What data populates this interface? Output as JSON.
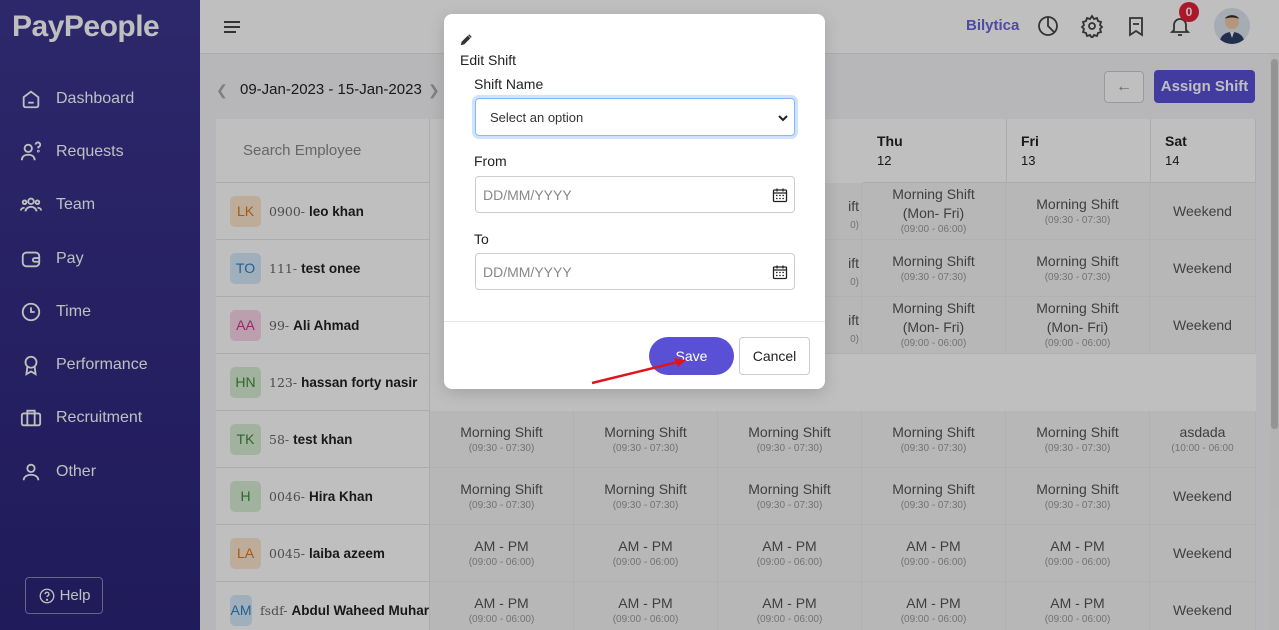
{
  "app": {
    "logo": "PayPeople",
    "brand": "Bilytica",
    "notifications": "0"
  },
  "sidebar": {
    "items": [
      {
        "label": "Dashboard",
        "icon": "home-icon"
      },
      {
        "label": "Requests",
        "icon": "user-question-icon"
      },
      {
        "label": "Team",
        "icon": "team-icon"
      },
      {
        "label": "Pay",
        "icon": "wallet-icon"
      },
      {
        "label": "Time",
        "icon": "clock-icon"
      },
      {
        "label": "Performance",
        "icon": "award-icon"
      },
      {
        "label": "Recruitment",
        "icon": "briefcase-icon"
      },
      {
        "label": "Other",
        "icon": "person-icon"
      }
    ],
    "help": "Help"
  },
  "toolbar": {
    "date_range": "09-Jan-2023 - 15-Jan-2023",
    "assign_label": "Assign Shift"
  },
  "grid": {
    "search_placeholder": "Search Employee",
    "days": [
      {
        "name": "Thu",
        "num": "12"
      },
      {
        "name": "Fri",
        "num": "13"
      },
      {
        "name": "Sat",
        "num": "14"
      }
    ],
    "employees": [
      {
        "initials": "LK",
        "code": "0900-",
        "name": "leo khan",
        "color": "#fde6cc",
        "fg": "#d97a1e"
      },
      {
        "initials": "TO",
        "code": "111-",
        "name": "test onee",
        "color": "#d5ebfb",
        "fg": "#2f7fc1"
      },
      {
        "initials": "AA",
        "code": "99-",
        "name": "Ali Ahmad",
        "color": "#fbd5ea",
        "fg": "#c7388a"
      },
      {
        "initials": "HN",
        "code": "123-",
        "name": "hassan forty nasir",
        "color": "#d7efd3",
        "fg": "#3c8a37"
      },
      {
        "initials": "TK",
        "code": "58-",
        "name": "test khan",
        "color": "#d7efd3",
        "fg": "#3c8a37"
      },
      {
        "initials": "H",
        "code": "0046-",
        "name": "Hira Khan",
        "color": "#d7efd3",
        "fg": "#3c8a37"
      },
      {
        "initials": "LA",
        "code": "0045-",
        "name": "laiba azeem",
        "color": "#fde6cc",
        "fg": "#d97a1e"
      },
      {
        "initials": "AM",
        "code": "fsdf-",
        "name": "Abdul Waheed Muhar",
        "color": "#d5ebfb",
        "fg": "#2f7fc1"
      }
    ],
    "rows": [
      [
        {
          "n": "",
          "t": "",
          "partial": "ift",
          "pt": "0)"
        },
        {
          "n": "Morning Shift\n(Mon- Fri)",
          "t": "(09:00 - 06:00)"
        },
        {
          "n": "Morning Shift",
          "t": "(09:30 - 07:30)"
        },
        {
          "n": "Weekend",
          "t": ""
        }
      ],
      [
        {
          "n": "",
          "t": "",
          "partial": "ift",
          "pt": "0)"
        },
        {
          "n": "Morning Shift",
          "t": "(09:30 - 07:30)"
        },
        {
          "n": "Morning Shift",
          "t": "(09:30 - 07:30)"
        },
        {
          "n": "Weekend",
          "t": ""
        }
      ],
      [
        {
          "n": "",
          "t": "",
          "partial": "ift",
          "pt": "0)"
        },
        {
          "n": "Morning Shift\n(Mon- Fri)",
          "t": "(09:00 - 06:00)"
        },
        {
          "n": "Morning Shift\n(Mon- Fri)",
          "t": "(09:00 - 06:00)"
        },
        {
          "n": "Weekend",
          "t": ""
        }
      ]
    ],
    "full_rows": [
      [
        {
          "n": "Morning Shift",
          "t": "(09:30 - 07:30)"
        },
        {
          "n": "Morning Shift",
          "t": "(09:30 - 07:30)"
        },
        {
          "n": "Morning Shift",
          "t": "(09:30 - 07:30)"
        },
        {
          "n": "Morning Shift",
          "t": "(09:30 - 07:30)"
        },
        {
          "n": "Morning Shift",
          "t": "(09:30 - 07:30)"
        },
        {
          "n": "asdada",
          "t": "(10:00 - 06:00"
        }
      ],
      [
        {
          "n": "Morning Shift",
          "t": "(09:30 - 07:30)"
        },
        {
          "n": "Morning Shift",
          "t": "(09:30 - 07:30)"
        },
        {
          "n": "Morning Shift",
          "t": "(09:30 - 07:30)"
        },
        {
          "n": "Morning Shift",
          "t": "(09:30 - 07:30)"
        },
        {
          "n": "Morning Shift",
          "t": "(09:30 - 07:30)"
        },
        {
          "n": "Weekend",
          "t": ""
        }
      ],
      [
        {
          "n": "AM - PM",
          "t": "(09:00 - 06:00)"
        },
        {
          "n": "AM - PM",
          "t": "(09:00 - 06:00)"
        },
        {
          "n": "AM - PM",
          "t": "(09:00 - 06:00)"
        },
        {
          "n": "AM - PM",
          "t": "(09:00 - 06:00)"
        },
        {
          "n": "AM - PM",
          "t": "(09:00 - 06:00)"
        },
        {
          "n": "Weekend",
          "t": ""
        }
      ],
      [
        {
          "n": "AM - PM",
          "t": "(09:00 - 06:00)"
        },
        {
          "n": "AM - PM",
          "t": "(09:00 - 06:00)"
        },
        {
          "n": "AM - PM",
          "t": "(09:00 - 06:00)"
        },
        {
          "n": "AM - PM",
          "t": "(09:00 - 06:00)"
        },
        {
          "n": "AM - PM",
          "t": "(09:00 - 06:00)"
        },
        {
          "n": "Weekend",
          "t": ""
        }
      ]
    ]
  },
  "modal": {
    "title": "Edit Shift",
    "shift_label": "Shift Name",
    "shift_value": "Select an option",
    "from_label": "From",
    "from_placeholder": "DD/MM/YYYY",
    "to_label": "To",
    "to_placeholder": "DD/MM/YYYY",
    "save_label": "Save",
    "cancel_label": "Cancel"
  },
  "colors": {
    "accent": "#5a50d6",
    "sidebar": "#2f2880",
    "badge": "#e5213a"
  }
}
